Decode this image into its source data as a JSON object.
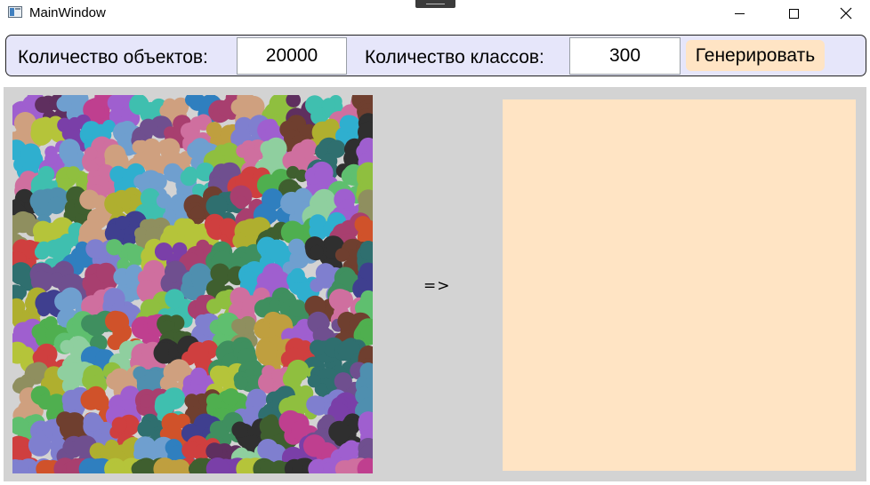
{
  "window": {
    "title": "MainWindow",
    "controls": [
      "minimize-icon",
      "maximize-icon",
      "close-icon"
    ]
  },
  "toolbar": {
    "objects_label": "Количество объектов:",
    "objects_value": "20000",
    "classes_label": "Количество классов:",
    "classes_value": "300",
    "generate_label": "Генерировать"
  },
  "main": {
    "arrow": "=>",
    "input_canvas": {
      "description_icon": "scatter-canvas"
    },
    "result_canvas": {
      "background": "#ffe4c4"
    }
  },
  "colors": {
    "toolbar_bg": "#e6e6fa",
    "button_bg": "#ffe4c4",
    "workspace_bg": "#d3d3d3",
    "result_bg": "#ffe4c4"
  }
}
